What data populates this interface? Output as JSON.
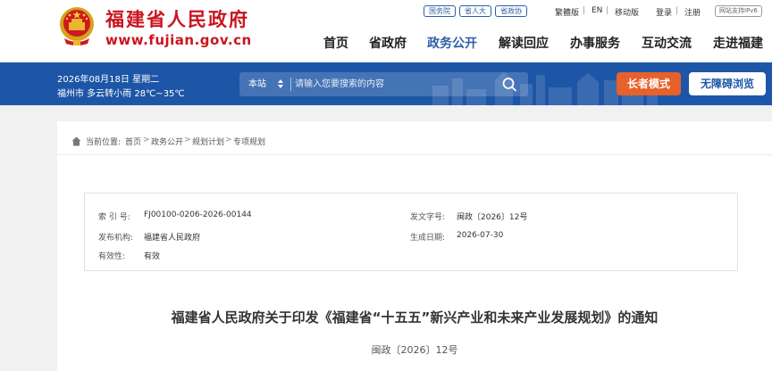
{
  "header": {
    "site_name": "福建省人民政府",
    "site_url": "www.fujian.gov.cn",
    "top_links": [
      "国务院",
      "省人大",
      "省政协"
    ],
    "utility_links": {
      "traditional": "繁體版",
      "english": "EN",
      "mobile": "移动版",
      "login": "登录",
      "register": "注册",
      "ipv6": "网站支持IPv6"
    },
    "nav": [
      "首页",
      "省政府",
      "政务公开",
      "解读回应",
      "办事服务",
      "互动交流",
      "走进福建"
    ],
    "active_nav": "政务公开",
    "brand_color": "#c9151e",
    "accent_color": "#2d5ea8"
  },
  "banner": {
    "date": "2026年08月18日 星期二",
    "weather": "福州市 多云转小雨 28℃~35℃",
    "search_scope": "本站",
    "search_placeholder": "请输入您要搜索的内容",
    "elder_mode": "长者模式",
    "accessibility": "无障碍浏览",
    "banner_color": "#1d56a6",
    "elder_color": "#e8602a"
  },
  "breadcrumb": {
    "label": "当前位置:",
    "items": [
      "首页",
      "政务公开",
      "规划计划",
      "专项规划"
    ]
  },
  "meta": {
    "index_label": "索 引 号:",
    "index_value": "FJ00100-0206-2026-00144",
    "doc_no_label": "发文字号:",
    "doc_no_value": "闽政〔2026〕12号",
    "publisher_label": "发布机构:",
    "publisher_value": "福建省人民政府",
    "date_label": "生成日期:",
    "date_value": "2026-07-30",
    "validity_label": "有效性:",
    "validity_value": "有效"
  },
  "document": {
    "title": "福建省人民政府关于印发《福建省“十五五”新兴产业和未来产业发展规划》的通知",
    "number": "闽政〔2026〕12号"
  }
}
